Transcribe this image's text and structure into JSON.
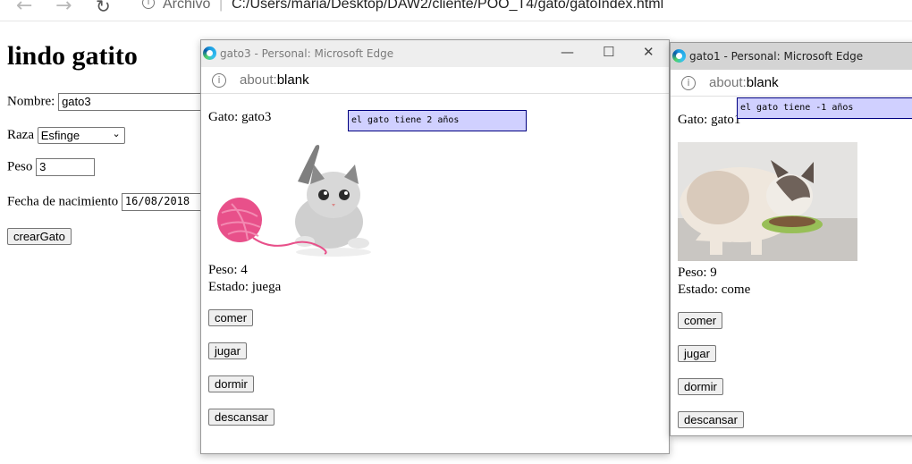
{
  "browser": {
    "address_label": "Archivo",
    "address_path": "C:/Users/maria/Desktop/DAW2/cliente/POO_T4/gato/gatoIndex.html"
  },
  "form": {
    "title": "lindo gatito",
    "nombre_label": "Nombre:",
    "nombre_value": "gato3",
    "raza_label": "Raza",
    "raza_value": "Esfinge",
    "peso_label": "Peso",
    "peso_value": "3",
    "fecha_label": "Fecha de nacimiento",
    "fecha_value": "16/08/2018",
    "submit_label": "crearGato"
  },
  "windows": [
    {
      "title": "gato3 - Personal: Microsoft Edge",
      "url_scheme": "about:",
      "url_host": "blank",
      "alert": "el gato tiene 2 años",
      "gato_line": "Gato: gato3",
      "peso_line": "Peso: 4",
      "estado_line": "Estado: juega",
      "buttons": [
        "comer",
        "jugar",
        "dormir",
        "descansar"
      ]
    },
    {
      "title": "gato1 - Personal: Microsoft Edge",
      "url_scheme": "about:",
      "url_host": "blank",
      "alert": "el gato tiene -1 años",
      "gato_line": "Gato: gato1",
      "peso_line": "Peso: 9",
      "estado_line": "Estado: come",
      "buttons": [
        "comer",
        "jugar",
        "dormir",
        "descansar"
      ]
    }
  ]
}
